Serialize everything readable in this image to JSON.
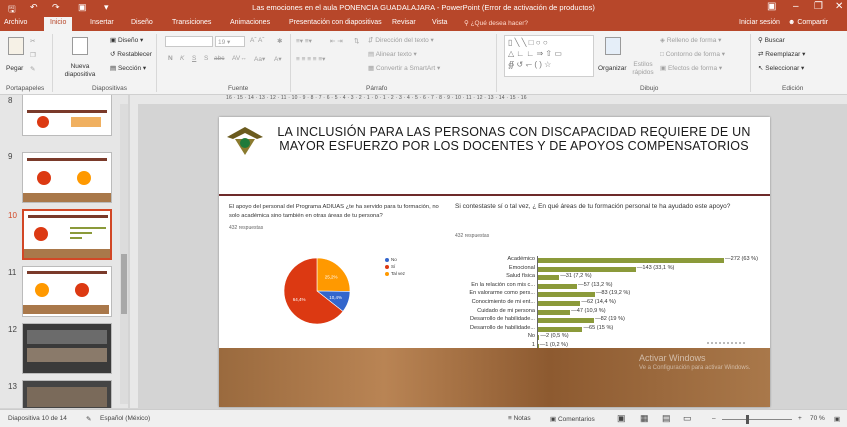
{
  "window": {
    "title": "Las emociones en el aula PONENCIA GUADALAJARA - PowerPoint (Error de activación de productos)",
    "sign_in": "Iniciar sesión",
    "share": "Compartir"
  },
  "ribbon_tabs": [
    "Archivo",
    "Inicio",
    "Insertar",
    "Diseño",
    "Transiciones",
    "Animaciones",
    "Presentación con diapositivas",
    "Revisar",
    "Vista"
  ],
  "tell_me": "¿Qué desea hacer?",
  "ribbon": {
    "paste": "Pegar",
    "clipboard_group": "Portapapeles",
    "new_slide": "Nueva diapositiva",
    "layout": "Diseño",
    "reset": "Restablecer",
    "section": "Sección",
    "slides_group": "Diapositivas",
    "font_size": "19",
    "font_group": "Fuente",
    "text_direction": "Dirección del texto",
    "align_text": "Alinear texto",
    "smartart": "Convertir a SmartArt",
    "paragraph_group": "Párrafo",
    "arrange": "Organizar",
    "quick_styles": "Estilos rápidos",
    "shape_fill": "Relleno de forma",
    "shape_outline": "Contorno de forma",
    "shape_effects": "Efectos de forma",
    "drawing_group": "Dibujo",
    "find": "Buscar",
    "replace": "Reemplazar",
    "select": "Seleccionar",
    "editing_group": "Edición"
  },
  "ruler_text": "16 · 15 · 14 · 13 · 12 · 11 · 10 · 9 · 8 · 7 · 6 · 5 · 4 · 3 · 2 · 1 · 0 · 1 · 2 · 3 · 4 · 5 · 6 · 7 · 8 · 9 · 10 · 11 · 12 · 13 · 14 · 15 · 16",
  "thumbnails": [
    {
      "num": "8"
    },
    {
      "num": "9"
    },
    {
      "num": "10"
    },
    {
      "num": "11"
    },
    {
      "num": "12"
    },
    {
      "num": "13"
    }
  ],
  "slide": {
    "title": "LA INCLUSIÓN PARA LAS PERSONAS CON DISCAPACIDAD REQUIERE DE UN MAYOR ESFUERZO POR LOS DOCENTES Y DE APOYOS COMPENSATORIOS",
    "left_question": "El apoyo del personal del Programa ADIUAS ¿te ha servido para tu formación, no solo académica sino también en otras áreas de tu persona?",
    "left_responses": "432 respuestas",
    "right_question": "Si contestaste sí o tal vez, ¿ En qué áreas de tu formación personal te ha ayudado este apoyo?",
    "right_responses": "432 respuestas",
    "watermark_1": "Activar Windows",
    "watermark_2": "Ve a Configuración para activar Windows."
  },
  "chart_data": [
    {
      "type": "pie",
      "labels": [
        "No",
        "Sí",
        "Tal vez"
      ],
      "values": [
        10.4,
        64.4,
        25.2
      ],
      "value_labels": [
        "10,4%",
        "64,4%",
        "25,2%"
      ],
      "colors": [
        "#3366cc",
        "#dc3912",
        "#ff9900"
      ],
      "legend": "right"
    },
    {
      "type": "bar",
      "orientation": "horizontal",
      "categories": [
        "Académico",
        "Emocional",
        "Salud física",
        "En la relación con mis c...",
        "En valorarme como pers...",
        "Conocimiento de mi ent...",
        "Cuidado de mi persona",
        "Desarrollo de habilidade...",
        "Desarrollo de habilidade...",
        "No",
        "1"
      ],
      "values": [
        272,
        143,
        31,
        57,
        83,
        62,
        47,
        82,
        65,
        2,
        1
      ],
      "value_labels": [
        "272 (63 %)",
        "143 (33,1 %)",
        "31 (7,2 %)",
        "57 (13,2 %)",
        "83 (19,2 %)",
        "62 (14,4 %)",
        "47 (10,9 %)",
        "82 (19 %)",
        "65 (15 %)",
        "2 (0,5 %)",
        "1 (0,2 %)"
      ],
      "xlim": [
        0,
        272
      ],
      "color": "#8b9a3a"
    }
  ],
  "status": {
    "slide_info": "Diapositiva 10 de 14",
    "language": "Español (México)",
    "notes": "Notas",
    "comments": "Comentarios",
    "zoom": "70 %"
  }
}
